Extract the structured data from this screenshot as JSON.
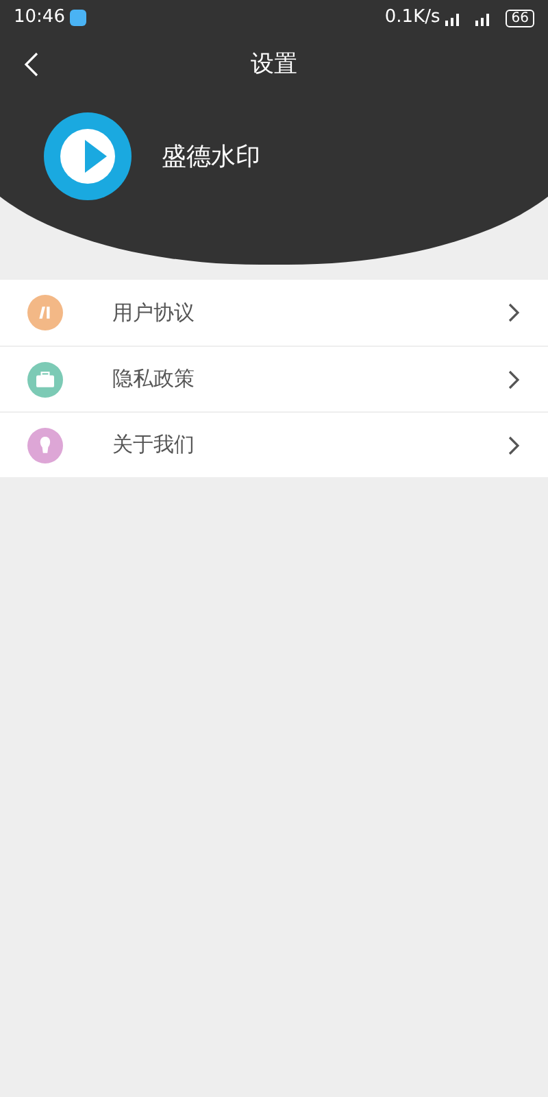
{
  "status_bar": {
    "time": "10:46",
    "speed": "0.1K/s",
    "battery": "66"
  },
  "header": {
    "title": "设置",
    "app_name": "盛德水印"
  },
  "menu": [
    {
      "label": "用户协议",
      "kind": "document",
      "color": "#f3b886"
    },
    {
      "label": "隐私政策",
      "kind": "briefcase",
      "color": "#7ccab5"
    },
    {
      "label": "关于我们",
      "kind": "bulb",
      "color": "#dda6d6"
    }
  ]
}
